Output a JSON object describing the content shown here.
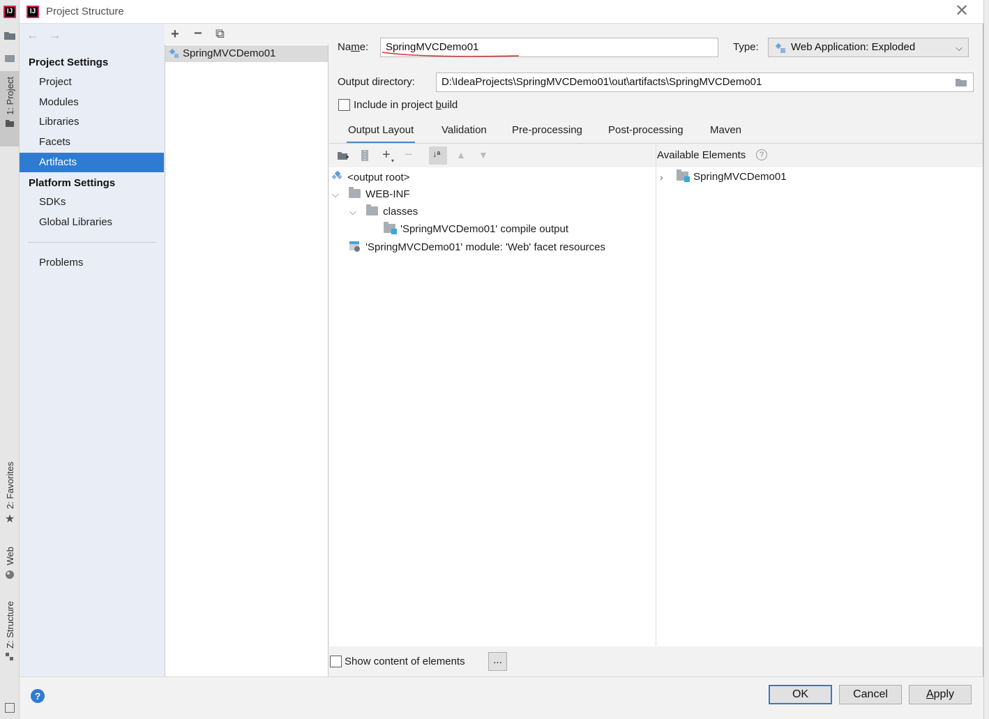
{
  "window": {
    "title": "Project Structure",
    "close_glyph": "✕",
    "logo_text": "IJ"
  },
  "ide_tool_strip": {
    "tabs": [
      {
        "label": "1: Project",
        "icon": "folder-icon",
        "active": true
      },
      {
        "label": "2: Favorites",
        "icon": "star-icon"
      },
      {
        "label": "Web",
        "icon": "globe-icon"
      },
      {
        "label": "Z: Structure",
        "icon": "structure-icon"
      }
    ]
  },
  "nav": {
    "back": "←",
    "forward": "→",
    "project_settings_header": "Project Settings",
    "project_settings_items": [
      "Project",
      "Modules",
      "Libraries",
      "Facets",
      "Artifacts"
    ],
    "selected": "Artifacts",
    "platform_settings_header": "Platform Settings",
    "platform_settings_items": [
      "SDKs",
      "Global Libraries"
    ],
    "problems": "Problems"
  },
  "artifact_list": {
    "toolbar": {
      "add": "+",
      "remove": "−",
      "copy": "⧉"
    },
    "items": [
      "SpringMVCDemo01"
    ]
  },
  "artifact": {
    "name_label": "Name:",
    "name_value": "SpringMVCDemo01",
    "type_label": "Type:",
    "type_value": "Web Application: Exploded",
    "output_dir_label": "Output directory:",
    "output_dir_value": "D:\\IdeaProjects\\SpringMVCDemo01\\out\\artifacts\\SpringMVCDemo01",
    "include_in_build_label": "Include in project build",
    "include_in_build_checked": false
  },
  "tabs": [
    "Output Layout",
    "Validation",
    "Pre-processing",
    "Post-processing",
    "Maven"
  ],
  "active_tab": "Output Layout",
  "output_layout": {
    "tree": [
      {
        "label": "<output root>",
        "icon": "artifact-root-icon",
        "level": 0
      },
      {
        "label": "WEB-INF",
        "icon": "folder-icon",
        "level": 0,
        "expanded": true
      },
      {
        "label": "classes",
        "icon": "folder-icon",
        "level": 1,
        "expanded": true
      },
      {
        "label": "'SpringMVCDemo01' compile output",
        "icon": "module-output-icon",
        "level": 2
      },
      {
        "label": "'SpringMVCDemo01' module: 'Web' facet resources",
        "icon": "web-facet-icon",
        "level": 0
      }
    ]
  },
  "available_elements": {
    "header": "Available Elements",
    "items": [
      {
        "label": "SpringMVCDemo01",
        "icon": "module-icon",
        "expanded": false
      }
    ]
  },
  "bottom": {
    "show_content_label": "Show content of elements",
    "show_content_checked": false,
    "ellipsis": "..."
  },
  "footer": {
    "help": "?",
    "ok": "OK",
    "cancel": "Cancel",
    "apply": "Apply"
  },
  "colors": {
    "selection": "#2f7bd2",
    "nav_bg": "#e9eef6",
    "red_underline": "#d32f2f"
  }
}
